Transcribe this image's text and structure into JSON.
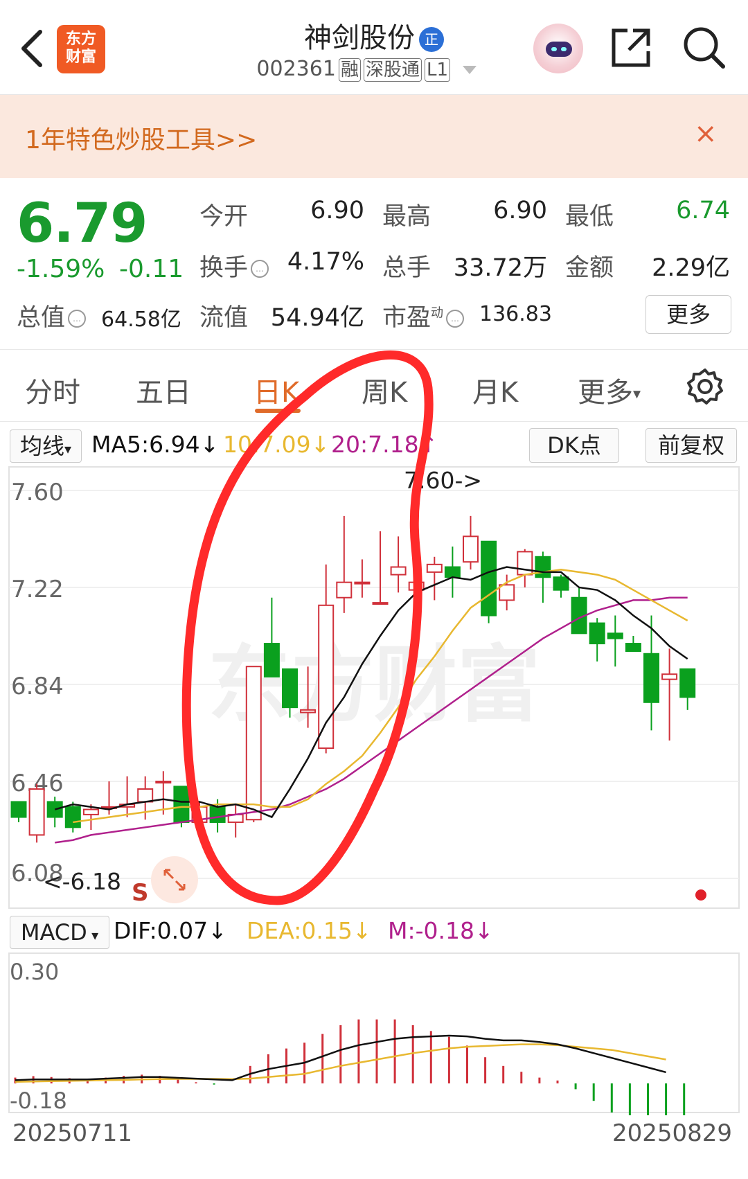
{
  "header": {
    "logo_text_1": "东方",
    "logo_text_2": "财富",
    "stock_name": "神剑股份",
    "badge": "正",
    "stock_code": "002361",
    "tags": [
      "融",
      "深股通",
      "L1"
    ]
  },
  "banner": {
    "text": "1年特色炒股工具>>",
    "close": "×"
  },
  "quote": {
    "price": "6.79",
    "change_pct": "-1.59%",
    "change": "-0.11",
    "open_label": "今开",
    "open": "6.90",
    "high_label": "最高",
    "high": "6.90",
    "low_label": "最低",
    "low": "6.74",
    "turnover_label": "换手",
    "turnover": "4.17%",
    "volume_label": "总手",
    "volume": "33.72万",
    "amount_label": "金额",
    "amount": "2.29亿",
    "mktcap_label": "总值",
    "mktcap": "64.58亿",
    "float_label": "流值",
    "float": "54.94亿",
    "pe_label": "市盈",
    "pe_sup": "动",
    "pe": "136.83",
    "more": "更多"
  },
  "tabs": [
    "分时",
    "五日",
    "日K",
    "周K",
    "月K",
    "更多"
  ],
  "active_tab": "日K",
  "ma_bar": {
    "selector": "均线",
    "ma5": "MA5:6.94",
    "ma10": "10:7.09",
    "ma20": "20:7.18",
    "dk": "DK点",
    "adjust": "前复权"
  },
  "macd_bar": {
    "selector": "MACD",
    "dif": "DIF:0.07",
    "dea": "DEA:0.15",
    "m": "M:-0.18"
  },
  "chart_labels": {
    "high_marker": "7.60->",
    "low_marker": "<-6.18",
    "s_marker": "S",
    "date_start": "20250711",
    "date_end": "20250829"
  },
  "colors": {
    "up": "#d0303a",
    "down": "#0aa01e",
    "ma5": "#111111",
    "ma10": "#e8b830",
    "ma20": "#b0208c",
    "accent": "#e06b2a",
    "annotation": "#ff2a2a"
  },
  "chart_data": [
    {
      "type": "candlestick",
      "title": "日K",
      "yticks": [
        7.6,
        7.22,
        6.84,
        6.46,
        6.08
      ],
      "ylim": [
        6.08,
        7.6
      ],
      "candles": [
        {
          "o": 6.38,
          "h": 6.38,
          "l": 6.3,
          "c": 6.32
        },
        {
          "o": 6.25,
          "h": 6.45,
          "l": 6.22,
          "c": 6.43
        },
        {
          "o": 6.38,
          "h": 6.4,
          "l": 6.28,
          "c": 6.32
        },
        {
          "o": 6.36,
          "h": 6.38,
          "l": 6.26,
          "c": 6.28
        },
        {
          "o": 6.33,
          "h": 6.37,
          "l": 6.27,
          "c": 6.35
        },
        {
          "o": 6.36,
          "h": 6.46,
          "l": 6.33,
          "c": 6.36
        },
        {
          "o": 6.36,
          "h": 6.48,
          "l": 6.32,
          "c": 6.37
        },
        {
          "o": 6.38,
          "h": 6.48,
          "l": 6.31,
          "c": 6.43
        },
        {
          "o": 6.46,
          "h": 6.5,
          "l": 6.33,
          "c": 6.46
        },
        {
          "o": 6.44,
          "h": 6.44,
          "l": 6.28,
          "c": 6.3
        },
        {
          "o": 6.3,
          "h": 6.38,
          "l": 6.28,
          "c": 6.36
        },
        {
          "o": 6.36,
          "h": 6.39,
          "l": 6.26,
          "c": 6.3
        },
        {
          "o": 6.3,
          "h": 6.37,
          "l": 6.24,
          "c": 6.33
        },
        {
          "o": 6.31,
          "h": 6.91,
          "l": 6.3,
          "c": 6.91
        },
        {
          "o": 7.0,
          "h": 7.18,
          "l": 6.93,
          "c": 6.87
        },
        {
          "o": 6.9,
          "h": 6.9,
          "l": 6.71,
          "c": 6.75
        },
        {
          "o": 6.73,
          "h": 6.91,
          "l": 6.67,
          "c": 6.74
        },
        {
          "o": 6.59,
          "h": 7.31,
          "l": 6.57,
          "c": 7.15
        },
        {
          "o": 7.18,
          "h": 7.5,
          "l": 7.12,
          "c": 7.24
        },
        {
          "o": 7.24,
          "h": 7.33,
          "l": 7.18,
          "c": 7.24
        },
        {
          "o": 7.16,
          "h": 7.44,
          "l": 7.16,
          "c": 7.16
        },
        {
          "o": 7.27,
          "h": 7.42,
          "l": 7.2,
          "c": 7.3
        },
        {
          "o": 7.21,
          "h": 7.32,
          "l": 7.18,
          "c": 7.24
        },
        {
          "o": 7.28,
          "h": 7.34,
          "l": 7.17,
          "c": 7.31
        },
        {
          "o": 7.3,
          "h": 7.38,
          "l": 7.18,
          "c": 7.26
        },
        {
          "o": 7.32,
          "h": 7.5,
          "l": 7.29,
          "c": 7.42
        },
        {
          "o": 7.4,
          "h": 7.4,
          "l": 7.08,
          "c": 7.11
        },
        {
          "o": 7.17,
          "h": 7.27,
          "l": 7.13,
          "c": 7.23
        },
        {
          "o": 7.27,
          "h": 7.37,
          "l": 7.22,
          "c": 7.36
        },
        {
          "o": 7.34,
          "h": 7.36,
          "l": 7.16,
          "c": 7.26
        },
        {
          "o": 7.26,
          "h": 7.27,
          "l": 7.18,
          "c": 7.21
        },
        {
          "o": 7.18,
          "h": 7.22,
          "l": 7.04,
          "c": 7.04
        },
        {
          "o": 7.08,
          "h": 7.1,
          "l": 6.93,
          "c": 7.0
        },
        {
          "o": 7.04,
          "h": 7.11,
          "l": 6.91,
          "c": 7.02
        },
        {
          "o": 7.0,
          "h": 7.03,
          "l": 6.97,
          "c": 6.97
        },
        {
          "o": 6.96,
          "h": 7.11,
          "l": 6.66,
          "c": 6.77
        },
        {
          "o": 6.86,
          "h": 6.98,
          "l": 6.62,
          "c": 6.88
        },
        {
          "o": 6.9,
          "h": 6.9,
          "l": 6.74,
          "c": 6.79
        }
      ],
      "ma5": [
        6.35,
        6.37,
        6.36,
        6.35,
        6.37,
        6.38,
        6.39,
        6.38,
        6.38,
        6.36,
        6.37,
        6.35,
        6.32,
        6.43,
        6.55,
        6.69,
        6.79,
        6.92,
        7.03,
        7.13,
        7.2,
        7.23,
        7.26,
        7.25,
        7.28,
        7.3,
        7.29,
        7.28,
        7.28,
        7.22,
        7.21,
        7.17,
        7.11,
        7.06,
        6.99,
        6.94
      ],
      "ma10": [
        6.3,
        6.31,
        6.32,
        6.33,
        6.34,
        6.35,
        6.36,
        6.36,
        6.37,
        6.37,
        6.37,
        6.36,
        6.36,
        6.39,
        6.45,
        6.5,
        6.56,
        6.65,
        6.75,
        6.86,
        6.95,
        7.05,
        7.14,
        7.19,
        7.24,
        7.27,
        7.28,
        7.29,
        7.28,
        7.27,
        7.25,
        7.21,
        7.17,
        7.13,
        7.09
      ],
      "ma20": [
        6.22,
        6.23,
        6.25,
        6.26,
        6.27,
        6.28,
        6.29,
        6.3,
        6.31,
        6.32,
        6.33,
        6.34,
        6.35,
        6.37,
        6.4,
        6.43,
        6.47,
        6.52,
        6.57,
        6.62,
        6.67,
        6.72,
        6.77,
        6.82,
        6.87,
        6.92,
        6.97,
        7.02,
        7.06,
        7.1,
        7.13,
        7.15,
        7.17,
        7.17,
        7.18,
        7.18
      ]
    },
    {
      "type": "bar",
      "title": "MACD",
      "yticks": [
        0.3,
        -0.18
      ],
      "ylim": [
        -0.18,
        0.3
      ],
      "dif": [
        0.02,
        0.025,
        0.025,
        0.025,
        0.025,
        0.03,
        0.035,
        0.04,
        0.04,
        0.035,
        0.03,
        0.025,
        0.02,
        0.06,
        0.09,
        0.11,
        0.13,
        0.17,
        0.21,
        0.24,
        0.26,
        0.28,
        0.29,
        0.295,
        0.3,
        0.295,
        0.28,
        0.27,
        0.27,
        0.26,
        0.245,
        0.22,
        0.19,
        0.16,
        0.13,
        0.1,
        0.07
      ],
      "dea": [
        0.01,
        0.012,
        0.014,
        0.016,
        0.018,
        0.02,
        0.022,
        0.025,
        0.027,
        0.028,
        0.028,
        0.028,
        0.027,
        0.03,
        0.04,
        0.05,
        0.06,
        0.085,
        0.11,
        0.13,
        0.15,
        0.17,
        0.19,
        0.205,
        0.22,
        0.23,
        0.235,
        0.24,
        0.245,
        0.245,
        0.24,
        0.23,
        0.22,
        0.21,
        0.19,
        0.17,
        0.15
      ],
      "m": [
        0.02,
        0.025,
        0.022,
        0.018,
        0.014,
        0.02,
        0.026,
        0.03,
        0.026,
        0.014,
        0.004,
        -0.004,
        0.0,
        0.06,
        0.1,
        0.12,
        0.14,
        0.17,
        0.2,
        0.22,
        0.22,
        0.22,
        0.2,
        0.18,
        0.16,
        0.13,
        0.09,
        0.06,
        0.04,
        0.02,
        0.01,
        -0.02,
        -0.06,
        -0.1,
        -0.12,
        -0.14,
        -0.16,
        -0.18
      ]
    }
  ]
}
